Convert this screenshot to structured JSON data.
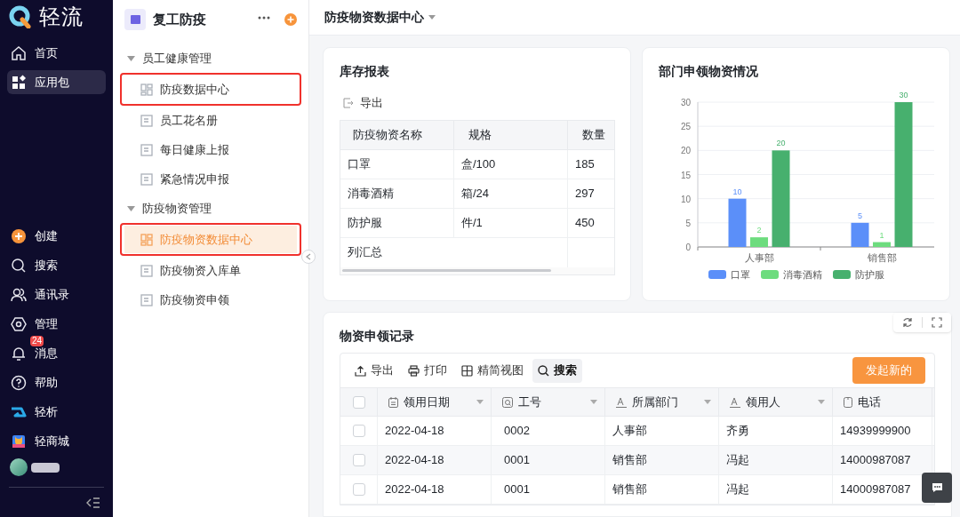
{
  "brand": {
    "name": "轻流"
  },
  "nav": {
    "top": [
      {
        "label": "首页",
        "kind": "home",
        "selected": false
      },
      {
        "label": "应用包",
        "kind": "apps",
        "selected": true
      }
    ],
    "bottom": [
      {
        "label": "创建",
        "kind": "create"
      },
      {
        "label": "搜索",
        "kind": "search"
      },
      {
        "label": "通讯录",
        "kind": "contacts"
      },
      {
        "label": "管理",
        "kind": "manage"
      },
      {
        "label": "消息",
        "kind": "bell",
        "badge": "24"
      },
      {
        "label": "帮助",
        "kind": "help"
      },
      {
        "label": "轻析",
        "kind": "analysis"
      },
      {
        "label": "轻商城",
        "kind": "shop"
      }
    ]
  },
  "app": {
    "title": "复工防疫",
    "groups": [
      {
        "label": "员工健康管理",
        "expanded": true,
        "children": [
          {
            "label": "防疫数据中心",
            "kind": "dashboard",
            "selected": false,
            "highlighted": true
          },
          {
            "label": "员工花名册",
            "kind": "form",
            "selected": false,
            "highlighted": false
          },
          {
            "label": "每日健康上报",
            "kind": "form",
            "selected": false,
            "highlighted": false
          },
          {
            "label": "紧急情况申报",
            "kind": "form",
            "selected": false,
            "highlighted": false
          }
        ]
      },
      {
        "label": "防疫物资管理",
        "expanded": true,
        "children": [
          {
            "label": "防疫物资数据中心",
            "kind": "dashboard",
            "selected": true,
            "highlighted": true
          },
          {
            "label": "防疫物资入库单",
            "kind": "form",
            "selected": false,
            "highlighted": false
          },
          {
            "label": "防疫物资申领",
            "kind": "form",
            "selected": false,
            "highlighted": false
          }
        ]
      }
    ]
  },
  "page": {
    "title": "防疫物资数据中心"
  },
  "inventory": {
    "title": "库存报表",
    "export": "导出",
    "columns": [
      "防疫物资名称",
      "规格",
      "数量"
    ],
    "rows": [
      [
        "口罩",
        "盒/100",
        "185"
      ],
      [
        "消毒酒精",
        "箱/24",
        "297"
      ],
      [
        "防护服",
        "件/1",
        "450"
      ]
    ],
    "summary": "列汇总"
  },
  "chart": {
    "title": "部门申领物资情况",
    "chart_data": {
      "type": "bar",
      "categories": [
        "人事部",
        "销售部"
      ],
      "series": [
        {
          "name": "口罩",
          "color": "#5b8ff9",
          "values": [
            10,
            5
          ]
        },
        {
          "name": "消毒酒精",
          "color": "#6ddc7e",
          "values": [
            2,
            1
          ]
        },
        {
          "name": "防护服",
          "color": "#47b06e",
          "values": [
            20,
            30
          ]
        }
      ],
      "ylim": [
        0,
        30
      ],
      "grid": true,
      "yticks": [
        0,
        5,
        10,
        15,
        20,
        25,
        30
      ],
      "data_labels": true
    }
  },
  "records": {
    "title": "物资申领记录",
    "tools": [
      {
        "label": "导出",
        "kind": "export",
        "selected": false
      },
      {
        "label": "打印",
        "kind": "print",
        "selected": false
      },
      {
        "label": "精简视图",
        "kind": "grid",
        "selected": false
      },
      {
        "label": "搜索",
        "kind": "search",
        "selected": true
      }
    ],
    "new_button": "发起新的",
    "all_checked": false,
    "columns": [
      {
        "label": "领用日期",
        "kind": "date"
      },
      {
        "label": "工号",
        "kind": "serial"
      },
      {
        "label": "所属部门",
        "kind": "text"
      },
      {
        "label": "领用人",
        "kind": "text"
      },
      {
        "label": "电话",
        "kind": "phone"
      }
    ],
    "rows": [
      {
        "checked": false,
        "cells": [
          "2022-04-18",
          "0002",
          "人事部",
          "齐勇",
          "14939999900"
        ]
      },
      {
        "checked": false,
        "cells": [
          "2022-04-18",
          "0001",
          "销售部",
          "冯起",
          "14000987087"
        ]
      },
      {
        "checked": false,
        "cells": [
          "2022-04-18",
          "0001",
          "销售部",
          "冯起",
          "14000987087"
        ]
      }
    ]
  }
}
